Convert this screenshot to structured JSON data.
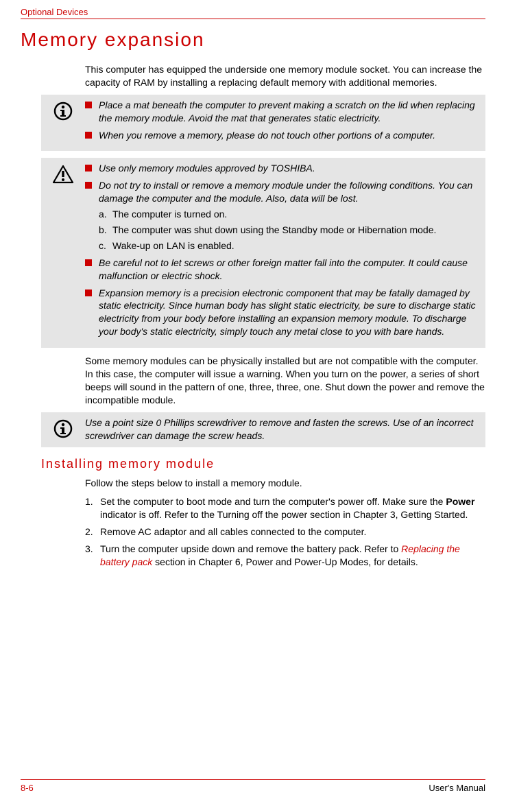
{
  "header": {
    "running": "Optional Devices"
  },
  "h1": "Memory expansion",
  "intro": "This computer has equipped the underside one memory module socket. You can increase the capacity of RAM by installing a replacing default memory with additional memories.",
  "note1": {
    "items": [
      "Place a mat beneath the computer to prevent making a scratch on the lid when replacing the memory module. Avoid the mat that generates static electricity.",
      "When you remove a memory, please do not touch other portions of a computer."
    ]
  },
  "note2": {
    "items": [
      {
        "text": "Use only memory modules approved by TOSHIBA."
      },
      {
        "text": "Do not try to install or remove a memory module under the following conditions. You can damage the computer and the module. Also, data will be lost.",
        "sub": [
          {
            "letter": "a.",
            "text": "The computer is turned on."
          },
          {
            "letter": "b.",
            "text": "The computer was shut down using the Standby mode or Hibernation mode."
          },
          {
            "letter": "c.",
            "text": "Wake-up on LAN is enabled."
          }
        ]
      },
      {
        "text": "Be careful not to let screws or other foreign matter fall into the computer. It could cause malfunction or electric shock."
      },
      {
        "text": "Expansion memory is a precision electronic component that may be fatally damaged by static electricity. Since human body has slight static electricity, be sure to discharge static electricity from your body before installing an expansion memory module. To discharge your body's static electricity, simply touch any metal close to you with bare hands."
      }
    ]
  },
  "para2": "Some memory modules can be physically installed but are not compatible with the computer. In this case, the computer will issue a warning. When you turn on the power, a series of short beeps will sound in the pattern of one, three, three, one. Shut down the power and remove the incompatible module.",
  "note3": "Use a point size 0 Phillips screwdriver to remove and fasten the screws. Use of an incorrect screwdriver can damage the screw heads.",
  "h2": "Installing memory module",
  "para3": "Follow the steps below to install a memory module.",
  "steps": {
    "s1a": "Set the computer to boot mode and turn the computer's power off. Make sure the ",
    "s1b": "Power",
    "s1c": " indicator is off. Refer to the Turning off the power section in Chapter 3, Getting Started.",
    "s2": "Remove AC adaptor and all cables connected to the computer.",
    "s3a": "Turn the computer upside down and remove the battery pack. Refer to ",
    "s3link": "Replacing the battery pack",
    "s3b": " section in Chapter 6, Power and Power-Up Modes, for details."
  },
  "footer": {
    "page": "8-6",
    "manual": "User's Manual"
  }
}
